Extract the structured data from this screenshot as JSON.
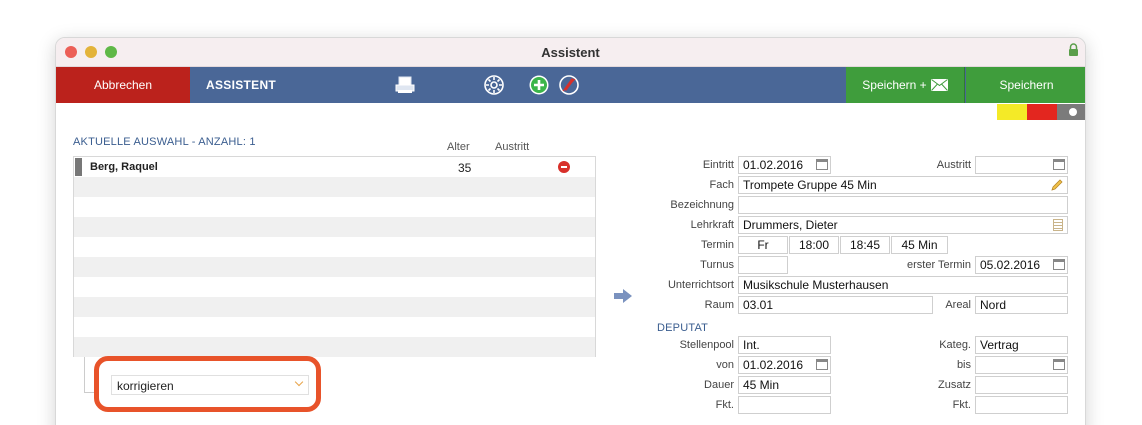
{
  "window": {
    "title": "Assistent"
  },
  "toolbar": {
    "cancel_label": "Abbrechen",
    "section_label": "ASSISTENT",
    "save_mail_label": "Speichern +",
    "save_label": "Speichern",
    "icons": [
      "printer-icon",
      "settings-gear-icon",
      "add-icon",
      "no-edit-icon",
      "envelope-icon"
    ]
  },
  "colors": {
    "cancel": "#bb221c",
    "toolbar": "#4a6797",
    "save": "#3f9d3c",
    "highlight": "#e8532a",
    "swatches": [
      "#f4ea27",
      "#e3261f",
      "#7b7b7b"
    ]
  },
  "selection": {
    "heading": "AKTUELLE AUSWAHL - ANZAHL: 1",
    "columns": [
      "Alter",
      "Austritt"
    ],
    "rows": [
      {
        "name": "Berg, Raquel",
        "age": "35",
        "exit": ""
      }
    ],
    "action_select": "korrigieren"
  },
  "form": {
    "eintritt_label": "Eintritt",
    "eintritt_value": "01.02.2016",
    "austritt_label": "Austritt",
    "austritt_value": "",
    "fach_label": "Fach",
    "fach_value": "Trompete Gruppe 45 Min",
    "bezeichnung_label": "Bezeichnung",
    "bezeichnung_value": "",
    "lehrkraft_label": "Lehrkraft",
    "lehrkraft_value": "Drummers, Dieter",
    "termin_label": "Termin",
    "termin_day": "Fr",
    "termin_start": "18:00",
    "termin_end": "18:45",
    "termin_duration": "45 Min",
    "turnus_label": "Turnus",
    "turnus_value": "",
    "erster_termin_label": "erster Termin",
    "erster_termin_value": "05.02.2016",
    "unterrichtsort_label": "Unterrichtsort",
    "unterrichtsort_value": "Musikschule Musterhausen",
    "raum_label": "Raum",
    "raum_value": "03.01",
    "areal_label": "Areal",
    "areal_value": "Nord"
  },
  "deputat": {
    "heading": "DEPUTAT",
    "stellenpool_label": "Stellenpool",
    "stellenpool_value": "Int.",
    "kateg_label": "Kateg.",
    "kateg_value": "Vertrag",
    "von_label": "von",
    "von_value": "01.02.2016",
    "bis_label": "bis",
    "bis_value": "",
    "dauer_label": "Dauer",
    "dauer_value": "45 Min",
    "zusatz_label": "Zusatz",
    "zusatz_value": "",
    "fkt1_label": "Fkt.",
    "fkt1_value": "",
    "fkt2_label": "Fkt.",
    "fkt2_value": ""
  }
}
